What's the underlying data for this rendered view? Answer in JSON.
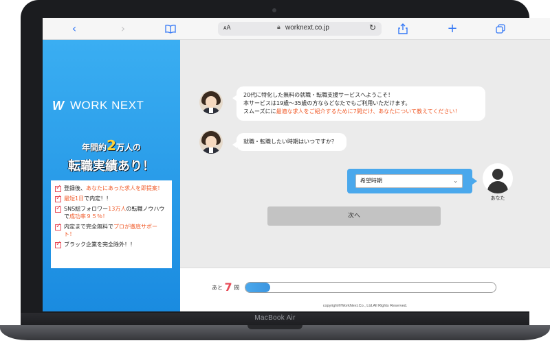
{
  "browser": {
    "text_size_label": "ᴀA",
    "url": "worknext.co.jp"
  },
  "ad": {
    "logo_text": "WORK NEXT",
    "tagline_pre": "年間約",
    "tagline_number": "2",
    "tagline_post": "万人の",
    "tagline_main": "転職実績あり！",
    "features": [
      {
        "parts": [
          {
            "t": "登録後、",
            "hl": false
          },
          {
            "t": "あなたにあった求人を即提案！",
            "hl": true
          }
        ]
      },
      {
        "parts": [
          {
            "t": "最短1日",
            "hl": true
          },
          {
            "t": "で内定！！",
            "hl": false
          }
        ]
      },
      {
        "parts": [
          {
            "t": "SNS総フォロワー",
            "hl": false
          },
          {
            "t": "13万人",
            "hl": true
          },
          {
            "t": "の転職ノウハウで",
            "hl": false
          },
          {
            "t": "成功率９５％！",
            "hl": true
          }
        ]
      },
      {
        "parts": [
          {
            "t": "内定まで完全無料で",
            "hl": false
          },
          {
            "t": "プロが徹底サポート！",
            "hl": true
          }
        ]
      },
      {
        "parts": [
          {
            "t": "ブラック企業を完全除外！！",
            "hl": false
          }
        ]
      }
    ]
  },
  "chat": {
    "message1_line1": "20代に特化した無料の就職・転職支援サービスへようこそ！",
    "message1_line2": "本サービスは19歳〜35歳の方ならどなたでもご利用いただけます。",
    "message1_line3_pre": "スムーズにに",
    "message1_line3_hl": "最適な求人をご紹介するために7問だけ、あなたについて教えてください！",
    "message2": "就職・転職したい時期はいつですか？",
    "select_value": "希望時期",
    "user_label": "あなた",
    "next_label": "次へ"
  },
  "progress": {
    "prefix": "あと",
    "remaining": "7",
    "suffix": "問",
    "fill_percent": 10
  },
  "footer": {
    "copyright": "copyright©WorkNext.Co., Ltd.All Rights Reserved."
  },
  "device": {
    "label": "MacBook Air"
  },
  "colors": {
    "accent_blue": "#3aaef2",
    "highlight_orange": "#f05a28",
    "safari_blue": "#3478f6"
  }
}
